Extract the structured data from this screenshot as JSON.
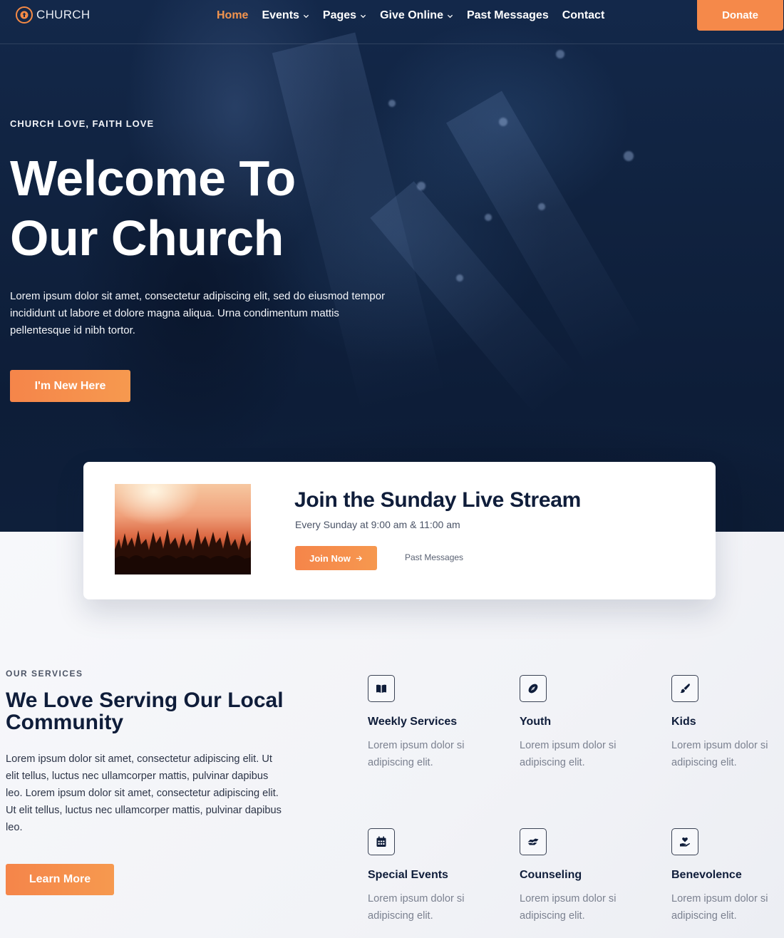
{
  "nav": {
    "logo_text": "CHURCH",
    "items": [
      {
        "label": "Home",
        "active": true,
        "dropdown": false
      },
      {
        "label": "Events",
        "active": false,
        "dropdown": true
      },
      {
        "label": "Pages",
        "active": false,
        "dropdown": true
      },
      {
        "label": "Give Online",
        "active": false,
        "dropdown": true
      },
      {
        "label": "Past Messages",
        "active": false,
        "dropdown": false
      },
      {
        "label": "Contact",
        "active": false,
        "dropdown": false
      }
    ],
    "donate_label": "Donate"
  },
  "hero": {
    "eyebrow": "CHURCH LOVE, FAITH LOVE",
    "title_line1": "Welcome To",
    "title_line2": "Our Church",
    "description": "Lorem ipsum dolor sit amet, consectetur adipiscing elit, sed do eiusmod tempor incididunt ut labore et dolore magna aliqua. Urna condimentum mattis pellentesque id nibh tortor.",
    "cta_label": "I'm New Here"
  },
  "stream": {
    "title": "Join the Sunday Live Stream",
    "schedule": "Every Sunday at 9:00 am & 11:00 am",
    "join_label": "Join Now",
    "past_label": "Past Messages"
  },
  "services": {
    "eyebrow": "OUR SERVICES",
    "title": "We Love Serving Our Local Community",
    "description": "Lorem ipsum dolor sit amet, consectetur adipiscing elit. Ut elit tellus, luctus nec ullamcorper mattis, pulvinar dapibus leo. Lorem ipsum dolor sit amet, consectetur adipiscing elit. Ut elit tellus, luctus nec ullamcorper mattis, pulvinar dapibus leo.",
    "cta_label": "Learn More",
    "items": [
      {
        "name": "Weekly Services",
        "text": "Lorem ipsum dolor si adipiscing elit.",
        "icon": "book-open-icon"
      },
      {
        "name": "Youth",
        "text": "Lorem ipsum dolor si adipiscing elit.",
        "icon": "football-icon"
      },
      {
        "name": "Kids",
        "text": "Lorem ipsum dolor si adipiscing elit.",
        "icon": "paint-brush-icon"
      },
      {
        "name": "Special Events",
        "text": "Lorem ipsum dolor si adipiscing elit.",
        "icon": "calendar-icon"
      },
      {
        "name": "Counseling",
        "text": "Lorem ipsum dolor si adipiscing elit.",
        "icon": "handshake-icon"
      },
      {
        "name": "Benevolence",
        "text": "Lorem ipsum dolor si adipiscing elit.",
        "icon": "hand-holding-heart-icon"
      }
    ]
  },
  "colors": {
    "accent": "#f5894a",
    "navy": "#0f1d3a",
    "hero_bg": "#10223f"
  }
}
